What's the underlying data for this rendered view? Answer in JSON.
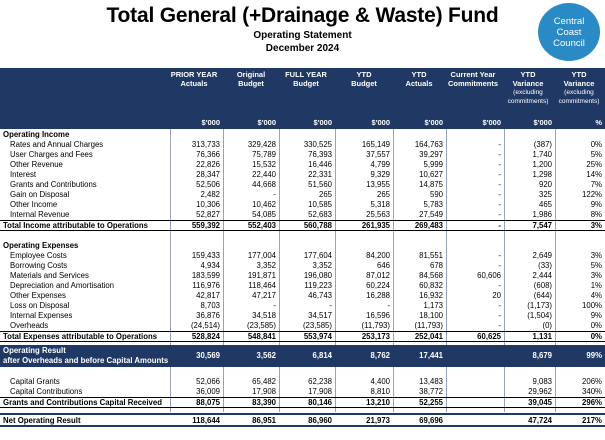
{
  "header": {
    "title": "Total General (+Drainage & Waste) Fund",
    "subtitle": "Operating Statement",
    "period": "December 2024",
    "logo_lines": [
      "Central",
      "Coast",
      "Council"
    ]
  },
  "columns": [
    {
      "label": "PRIOR YEAR\nActuals",
      "unit": "$'000"
    },
    {
      "label": "Original\nBudget",
      "unit": "$'000"
    },
    {
      "label": "FULL YEAR\nBudget",
      "unit": "$'000"
    },
    {
      "label": "YTD\nBudget",
      "unit": "$'000"
    },
    {
      "label": "YTD\nActuals",
      "unit": "$'000"
    },
    {
      "label": "Current Year\nCommitments",
      "unit": "$'000"
    },
    {
      "label": "YTD\nVariance",
      "sub": "(excluding\ncommitments)",
      "unit": "$'000"
    },
    {
      "label": "YTD\nVariance",
      "sub": "(excluding\ncommitments)",
      "unit": "%"
    }
  ],
  "income": {
    "heading": "Operating Income",
    "rows": [
      {
        "label": "Rates and Annual Charges",
        "v": [
          "313,733",
          "329,428",
          "330,525",
          "165,149",
          "164,763",
          "-",
          "(387)",
          "0%"
        ]
      },
      {
        "label": "User Charges and Fees",
        "v": [
          "76,366",
          "75,789",
          "76,393",
          "37,557",
          "39,297",
          "-",
          "1,740",
          "5%"
        ]
      },
      {
        "label": "Other Revenue",
        "v": [
          "22,826",
          "15,532",
          "16,446",
          "4,799",
          "5,999",
          "-",
          "1,200",
          "25%"
        ]
      },
      {
        "label": "Interest",
        "v": [
          "28,347",
          "22,440",
          "22,331",
          "9,329",
          "10,627",
          "-",
          "1,298",
          "14%"
        ]
      },
      {
        "label": "Grants and Contributions",
        "v": [
          "52,506",
          "44,668",
          "51,560",
          "13,955",
          "14,875",
          "-",
          "920",
          "7%"
        ]
      },
      {
        "label": "Gain on Disposal",
        "v": [
          "2,482",
          "-",
          "265",
          "265",
          "590",
          "-",
          "325",
          "122%"
        ]
      },
      {
        "label": "Other Income",
        "v": [
          "10,306",
          "10,462",
          "10,585",
          "5,318",
          "5,783",
          "-",
          "465",
          "9%"
        ]
      },
      {
        "label": "Internal Revenue",
        "v": [
          "52,827",
          "54,085",
          "52,683",
          "25,563",
          "27,549",
          "-",
          "1,986",
          "8%"
        ]
      }
    ],
    "total": {
      "label": "Total Income attributable to Operations",
      "v": [
        "559,392",
        "552,403",
        "560,788",
        "261,935",
        "269,483",
        "-",
        "7,547",
        "3%"
      ]
    }
  },
  "expenses": {
    "heading": "Operating Expenses",
    "rows": [
      {
        "label": "Employee Costs",
        "v": [
          "159,433",
          "177,004",
          "177,604",
          "84,200",
          "81,551",
          "-",
          "2,649",
          "3%"
        ]
      },
      {
        "label": "Borrowing Costs",
        "v": [
          "4,934",
          "3,352",
          "3,352",
          "646",
          "678",
          "-",
          "(33)",
          "5%"
        ]
      },
      {
        "label": "Materials and Services",
        "v": [
          "183,599",
          "191,871",
          "196,080",
          "87,012",
          "84,568",
          "60,606",
          "2,444",
          "3%"
        ]
      },
      {
        "label": "Depreciation and Amortisation",
        "v": [
          "116,976",
          "118,464",
          "119,223",
          "60,224",
          "60,832",
          "-",
          "(608)",
          "1%"
        ]
      },
      {
        "label": "Other Expenses",
        "v": [
          "42,817",
          "47,217",
          "46,743",
          "16,288",
          "16,932",
          "20",
          "(644)",
          "4%"
        ]
      },
      {
        "label": "Loss on Disposal",
        "v": [
          "8,703",
          "-",
          "-",
          "-",
          "1,173",
          "-",
          "(1,173)",
          "100%"
        ]
      },
      {
        "label": "Internal Expenses",
        "v": [
          "36,876",
          "34,518",
          "34,517",
          "16,596",
          "18,100",
          "-",
          "(1,504)",
          "9%"
        ]
      },
      {
        "label": "Overheads",
        "v": [
          "(24,514)",
          "(23,585)",
          "(23,585)",
          "(11,793)",
          "(11,793)",
          "-",
          "(0)",
          "0%"
        ]
      }
    ],
    "total": {
      "label": "Total Expenses attributable to Operations",
      "v": [
        "528,824",
        "548,841",
        "553,974",
        "253,173",
        "252,041",
        "60,625",
        "1,131",
        "0%"
      ]
    }
  },
  "operating_result": {
    "label1": "Operating Result",
    "label2": "after Overheads and before Capital Amounts",
    "v": [
      "30,569",
      "3,562",
      "6,814",
      "8,762",
      "17,441",
      "",
      "8,679",
      "99%"
    ]
  },
  "capital": {
    "rows": [
      {
        "label": "Capital Grants",
        "v": [
          "52,066",
          "65,482",
          "62,238",
          "4,400",
          "13,483",
          "",
          "9,083",
          "206%"
        ]
      },
      {
        "label": "Capital Contributions",
        "v": [
          "36,009",
          "17,908",
          "17,908",
          "8,810",
          "38,772",
          "",
          "29,962",
          "340%"
        ]
      }
    ],
    "total": {
      "label": "Grants and Contributions Capital Received",
      "v": [
        "88,075",
        "83,390",
        "80,146",
        "13,210",
        "52,255",
        "",
        "39,045",
        "296%"
      ]
    }
  },
  "net_result": {
    "label": "Net Operating Result",
    "v": [
      "118,644",
      "86,951",
      "86,960",
      "21,973",
      "69,696",
      "",
      "47,724",
      "217%"
    ]
  }
}
